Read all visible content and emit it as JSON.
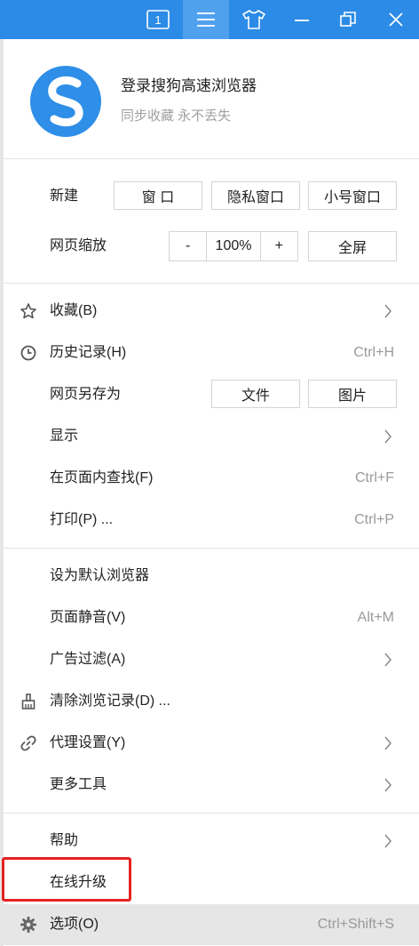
{
  "titlebar": {
    "tab_count": "1",
    "buttons": [
      "tab-counter-icon",
      "menu-icon",
      "skin-icon",
      "minimize-icon",
      "restore-icon",
      "close-icon"
    ]
  },
  "account": {
    "title": "登录搜狗高速浏览器",
    "subtitle": "同步收藏 永不丢失"
  },
  "new_window": {
    "label": "新建",
    "window": "窗 口",
    "private": "隐私窗口",
    "small": "小号窗口"
  },
  "zoom": {
    "label": "网页缩放",
    "minus": "-",
    "value": "100%",
    "plus": "+",
    "fullscreen": "全屏"
  },
  "menu": {
    "favorites": "收藏(B)",
    "history": "历史记录(H)",
    "history_shortcut": "Ctrl+H",
    "save_as": "网页另存为",
    "save_file": "文件",
    "save_image": "图片",
    "display": "显示",
    "find": "在页面内查找(F)",
    "find_shortcut": "Ctrl+F",
    "print": "打印(P) ...",
    "print_shortcut": "Ctrl+P",
    "set_default": "设为默认浏览器",
    "mute": "页面静音(V)",
    "mute_shortcut": "Alt+M",
    "adblock": "广告过滤(A)",
    "clear": "清除浏览记录(D) ...",
    "proxy": "代理设置(Y)",
    "more_tools": "更多工具",
    "help": "帮助",
    "upgrade": "在线升级",
    "options": "选项(O)",
    "options_shortcut": "Ctrl+Shift+S"
  },
  "colors": {
    "titlebar": "#2b8be6",
    "highlight": "#e52222",
    "hover": "#e6e6e6"
  }
}
